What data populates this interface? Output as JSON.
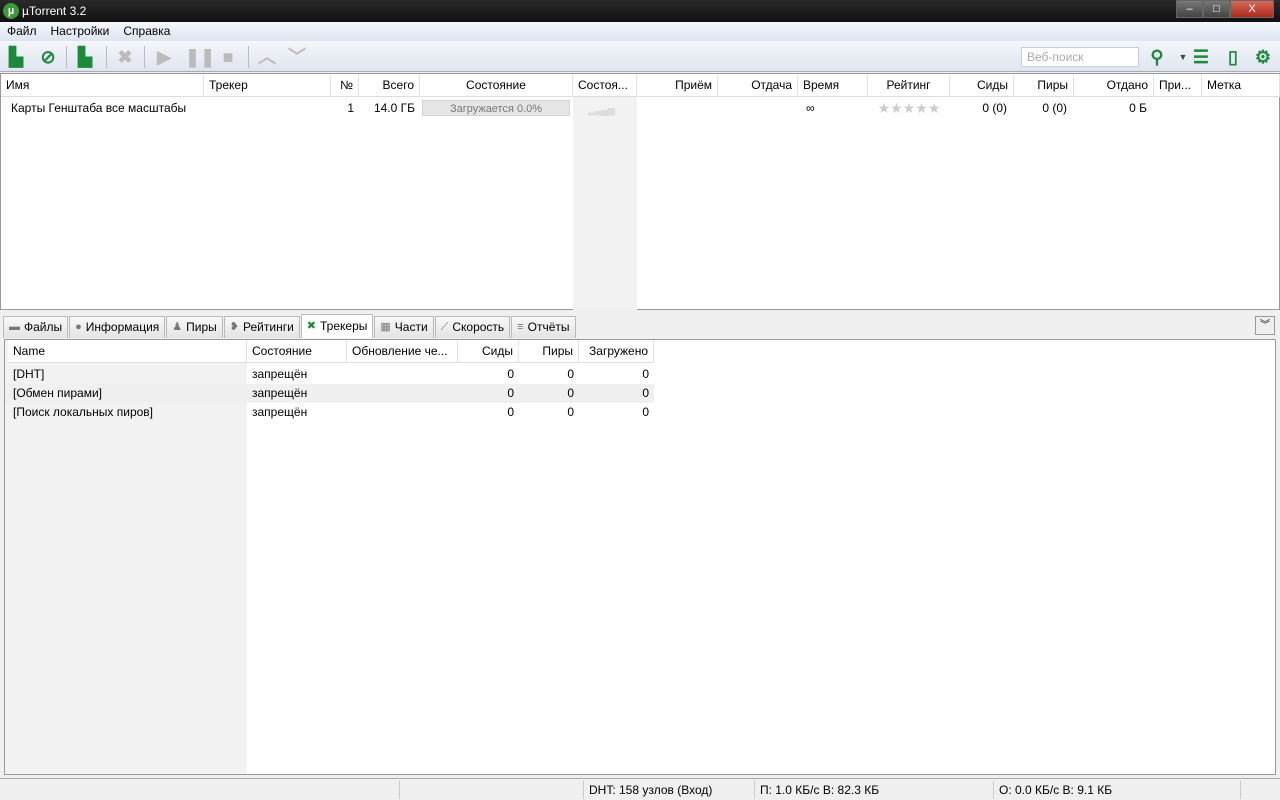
{
  "window": {
    "title": "µTorrent 3.2",
    "minimize": "–",
    "maximize": "□",
    "close": "X"
  },
  "menu": [
    "Файл",
    "Настройки",
    "Справка"
  ],
  "toolbar": {
    "search_placeholder": "Веб-поиск"
  },
  "torrent_columns": [
    "Имя",
    "Трекер",
    "№",
    "Всего",
    "Состояние",
    "Состоя...",
    "Приём",
    "Отдача",
    "Время",
    "Рейтинг",
    "Сиды",
    "Пиры",
    "Отдано",
    "При...",
    "Метка"
  ],
  "torrents": [
    {
      "name": "Карты Генштаба все масштабы",
      "tracker": "",
      "num": "1",
      "size": "14.0 ГБ",
      "status": "Загружается 0.0%",
      "progress": 0.0,
      "eta": "∞",
      "rating": "★★★★★",
      "seeds": "0 (0)",
      "peers": "0 (0)",
      "uploaded": "0 Б"
    }
  ],
  "tabs": [
    {
      "label": "Файлы",
      "icon": "folder-icon"
    },
    {
      "label": "Информация",
      "icon": "info-icon"
    },
    {
      "label": "Пиры",
      "icon": "peers-icon"
    },
    {
      "label": "Рейтинги",
      "icon": "ratings-icon"
    },
    {
      "label": "Трекеры",
      "icon": "trackers-icon"
    },
    {
      "label": "Части",
      "icon": "pieces-icon"
    },
    {
      "label": "Скорость",
      "icon": "speed-icon"
    },
    {
      "label": "Отчёты",
      "icon": "log-icon"
    }
  ],
  "tracker_columns": [
    "Name",
    "Состояние",
    "Обновление че...",
    "Сиды",
    "Пиры",
    "Загружено"
  ],
  "trackers": [
    {
      "name": "[DHT]",
      "status": "запрещён",
      "update": "",
      "seeds": "0",
      "peers": "0",
      "downloaded": "0"
    },
    {
      "name": "[Обмен пирами]",
      "status": "запрещён",
      "update": "",
      "seeds": "0",
      "peers": "0",
      "downloaded": "0"
    },
    {
      "name": "[Поиск локальных пиров]",
      "status": "запрещён",
      "update": "",
      "seeds": "0",
      "peers": "0",
      "downloaded": "0"
    }
  ],
  "statusbar": {
    "dht": "DHT: 158 узлов  (Вход)",
    "download": "П: 1.0 КБ/с В: 82.3 КБ",
    "upload": "О: 0.0 КБ/с В: 9.1 КБ"
  }
}
